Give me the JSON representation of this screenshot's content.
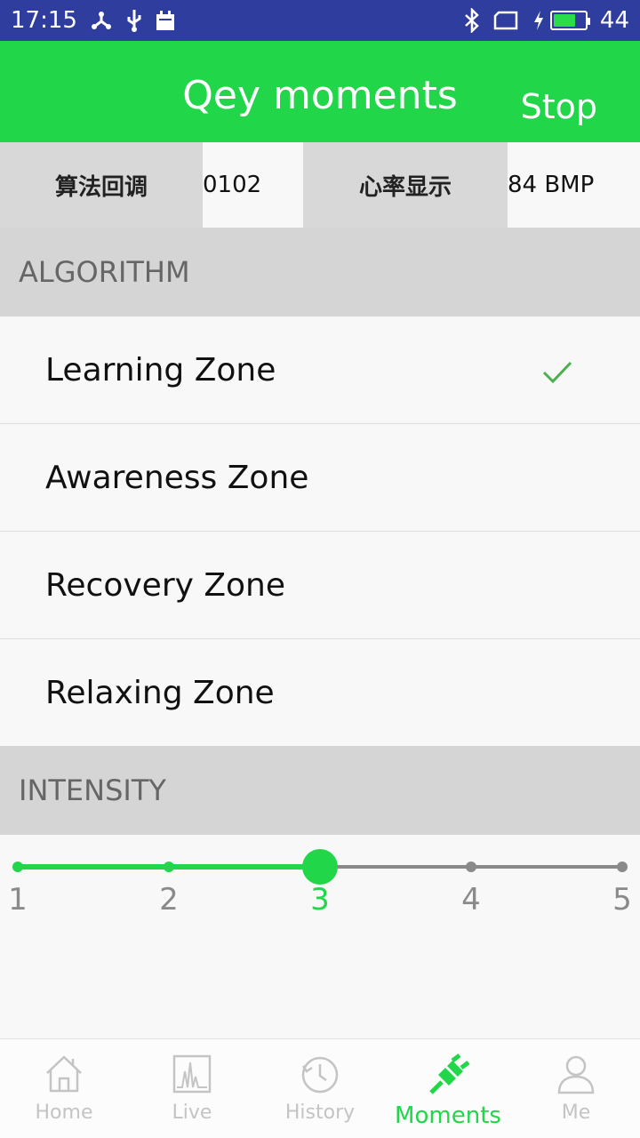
{
  "status_bar": {
    "time": "17:15",
    "battery_level": "44",
    "battery_fraction": 0.7,
    "icons": [
      "share-icon",
      "usb-icon",
      "calendar-icon",
      "bluetooth-icon",
      "screen-rotate-icon",
      "charging-icon",
      "battery-icon"
    ]
  },
  "app_bar": {
    "title": "Qey moments",
    "stop_label": "Stop"
  },
  "info": {
    "algorithm_label": "算法回调",
    "algorithm_value": "0102",
    "heart_label": "心率显示",
    "heart_value": "84 BMP"
  },
  "algorithm": {
    "header": "ALGORITHM",
    "items": [
      {
        "label": "Learning Zone",
        "selected": true
      },
      {
        "label": "Awareness Zone",
        "selected": false
      },
      {
        "label": "Recovery Zone",
        "selected": false
      },
      {
        "label": "Relaxing Zone",
        "selected": false
      }
    ]
  },
  "intensity": {
    "header": "INTENSITY",
    "levels": [
      "1",
      "2",
      "3",
      "4",
      "5"
    ],
    "selected": 3
  },
  "nav": {
    "items": [
      {
        "label": "Home",
        "icon": "home-icon"
      },
      {
        "label": "Live",
        "icon": "live-chart-icon"
      },
      {
        "label": "History",
        "icon": "history-icon"
      },
      {
        "label": "Moments",
        "icon": "plug-icon"
      },
      {
        "label": "Me",
        "icon": "user-icon"
      }
    ],
    "active": "Moments"
  },
  "colors": {
    "status_bar": "#2f3e9e",
    "accent": "#22d64a",
    "header_grey": "#d5d5d5",
    "check": "#4caf50"
  }
}
